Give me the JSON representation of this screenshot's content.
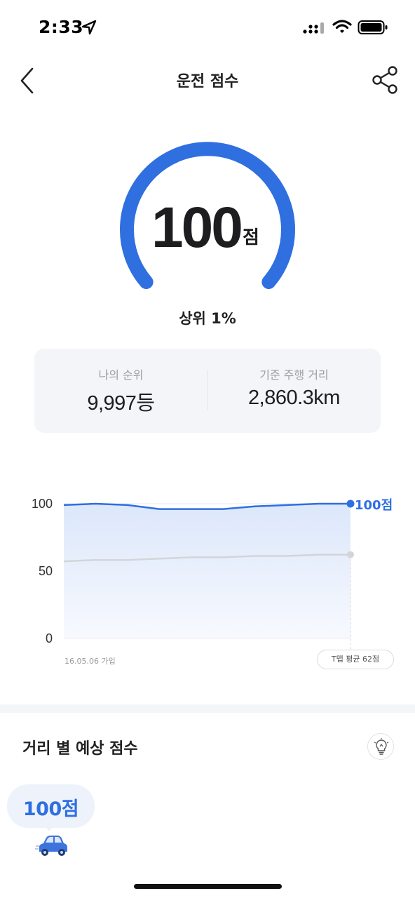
{
  "status_bar": {
    "time": "2:33",
    "icons": [
      "location-arrow-icon",
      "cellular-signal-icon",
      "wifi-icon",
      "battery-icon"
    ]
  },
  "nav": {
    "title": "운전 점수",
    "back_icon": "chevron-left-icon",
    "share_icon": "share-icon"
  },
  "score": {
    "value": "100",
    "unit": "점",
    "gauge_fill_fraction": 1.0,
    "rank_text": "상위 1%"
  },
  "stats": {
    "rank_label": "나의 순위",
    "rank_value": "9,997등",
    "distance_label": "기준 주행 거리",
    "distance_value": "2,860.3km"
  },
  "chart_data": {
    "type": "area",
    "y_ticks": [
      "100",
      "50",
      "0"
    ],
    "ylim": [
      0,
      100
    ],
    "grid": true,
    "series": [
      {
        "values": [
          99,
          100,
          99,
          96,
          96,
          96,
          98,
          99,
          100,
          100
        ]
      },
      {
        "values": [
          57,
          58,
          58,
          59,
          60,
          60,
          61,
          61,
          62,
          62
        ]
      }
    ],
    "end_label": "100점",
    "start_label": "16.05.06 가입",
    "avg_label": "T맵 평균 62점",
    "colors": {
      "user": "#2f6fe0",
      "average": "#d3d5d9"
    }
  },
  "section": {
    "title": "거리 별 예상 점수",
    "tip_icon": "lightbulb-icon",
    "bubble_score": "100점",
    "car_icon": "car-icon"
  },
  "colors": {
    "accent": "#2f6fe0",
    "card_bg": "#f3f5f8"
  }
}
